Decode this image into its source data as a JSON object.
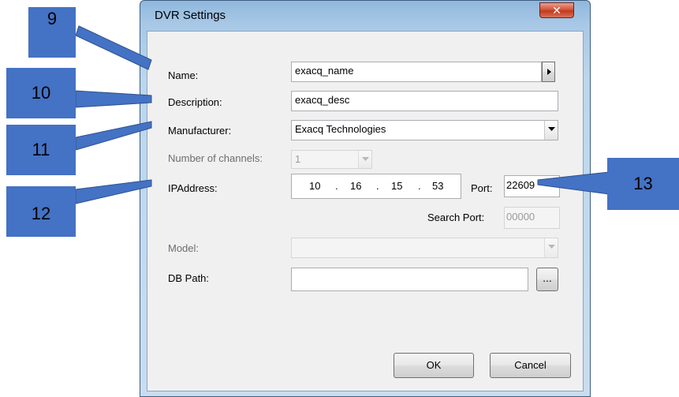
{
  "window": {
    "title": "DVR Settings",
    "close_icon": "close-icon"
  },
  "form": {
    "name": {
      "label": "Name:",
      "value": "exacq_name"
    },
    "description": {
      "label": "Description:",
      "value": "exacq_desc"
    },
    "manufacturer": {
      "label": "Manufacturer:",
      "value": "Exacq Technologies"
    },
    "channels": {
      "label": "Number of channels:",
      "value": "1"
    },
    "ip": {
      "label": "IPAddress:",
      "octets": [
        "10",
        "16",
        "15",
        "53"
      ]
    },
    "port": {
      "label": "Port:",
      "value": "22609"
    },
    "search_port": {
      "label": "Search Port:",
      "value": "00000"
    },
    "model": {
      "label": "Model:",
      "value": ""
    },
    "db_path": {
      "label": "DB Path:",
      "value": "",
      "browse_label": "..."
    }
  },
  "buttons": {
    "ok": "OK",
    "cancel": "Cancel"
  },
  "callouts": {
    "c9": "9",
    "c10": "10",
    "c11": "11",
    "c12": "12",
    "c13": "13"
  },
  "colors": {
    "callout": "#4472c4",
    "titlebar": "#a8c8e6",
    "close": "#c23a1f"
  }
}
